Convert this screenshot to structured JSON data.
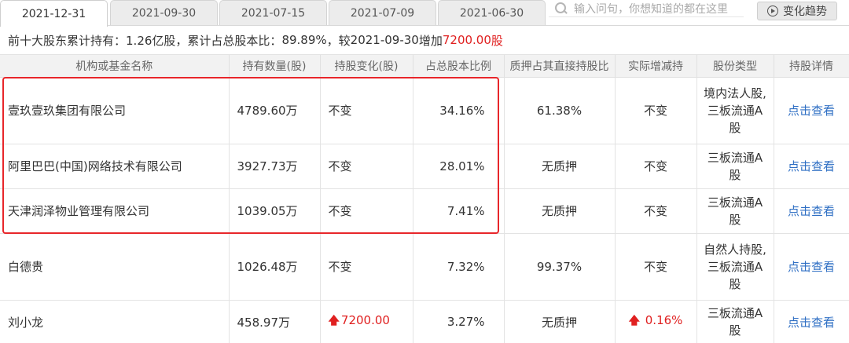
{
  "tabs": [
    "2021-12-31",
    "2021-09-30",
    "2021-07-15",
    "2021-07-09",
    "2021-06-30"
  ],
  "active_tab": "2021-12-31",
  "search": {
    "placeholder": "输入问句，你想知道的都在这里"
  },
  "trend_button": {
    "label": "变化趋势",
    "icon": "play-circle-icon"
  },
  "summary": {
    "prefix": "前十大股东累计持有：",
    "holding": "1.26亿股",
    "ratio_label": "，累计占总股本比：",
    "ratio": "89.89%",
    "compare_label": "，较",
    "compare_date": "2021-09-30",
    "increase_label": "增加",
    "increase_value": "7200.00",
    "unit": "股"
  },
  "table": {
    "headers": [
      "机构或基金名称",
      "持有数量(股)",
      "持股变化(股)",
      "占总股本比例",
      "质押占其直接持股比",
      "实际增减持",
      "股份类型",
      "持股详情"
    ],
    "rows": [
      {
        "name": "壹玖壹玖集团有限公司",
        "qty": "4789.60",
        "qty_unit": "万",
        "change": "不变",
        "change_up": false,
        "pct": "34.16%",
        "pledge": "61.38%",
        "actual": "不变",
        "actual_up": false,
        "type": "境内法人股,三板流通A股",
        "detail": "点击查看"
      },
      {
        "name": "阿里巴巴(中国)网络技术有限公司",
        "qty": "3927.73",
        "qty_unit": "万",
        "change": "不变",
        "change_up": false,
        "pct": "28.01%",
        "pledge": "无质押",
        "actual": "不变",
        "actual_up": false,
        "type": "三板流通A股",
        "detail": "点击查看"
      },
      {
        "name": "天津润泽物业管理有限公司",
        "qty": "1039.05",
        "qty_unit": "万",
        "change": "不变",
        "change_up": false,
        "pct": "7.41%",
        "pledge": "无质押",
        "actual": "不变",
        "actual_up": false,
        "type": "三板流通A股",
        "detail": "点击查看"
      },
      {
        "name": "白德贵",
        "qty": "1026.48",
        "qty_unit": "万",
        "change": "不变",
        "change_up": false,
        "pct": "7.32%",
        "pledge": "99.37%",
        "actual": "不变",
        "actual_up": false,
        "type": "自然人持股,三板流通A股",
        "detail": "点击查看"
      },
      {
        "name": "刘小龙",
        "qty": "458.97",
        "qty_unit": "万",
        "change": "7200.00",
        "change_up": true,
        "pct": "3.27%",
        "pledge": "无质押",
        "actual": "0.16%",
        "actual_up": true,
        "type": "三板流通A股",
        "detail": "点击查看"
      }
    ]
  },
  "colors": {
    "increase": "#e02020",
    "link": "#2f6fc4",
    "highlight_border": "#e8262a"
  }
}
